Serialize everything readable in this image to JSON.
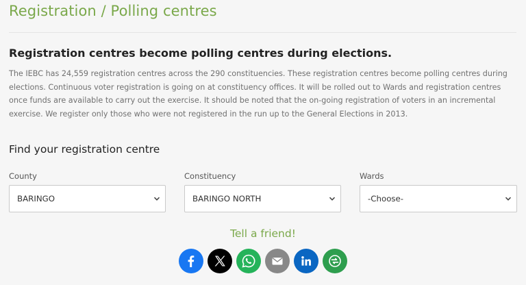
{
  "page_title": "Registration / Polling centres",
  "section_heading": "Registration centres become polling centres during elections.",
  "intro_text": "The IEBC has 24,559 registration centres across the 290 constituencies. These registration centres become polling centres during elections. Continuous voter registration is going on at constituency offices. It will be rolled out to Wards and registration centres once funds are available to carry out the exercise. It should be noted that the on-going registration of voters in an incremental exercise. We register only those who were not registered in the run up to the General Elections in 2013.",
  "find_heading": "Find your registration centre",
  "filters": {
    "county": {
      "label": "County",
      "value": "BARINGO"
    },
    "constituency": {
      "label": "Constituency",
      "value": "BARINGO NORTH"
    },
    "wards": {
      "label": "Wards",
      "value": "-Choose-"
    }
  },
  "share": {
    "title": "Tell a friend!",
    "buttons": [
      {
        "icon": "facebook-icon",
        "color": "#1877f2"
      },
      {
        "icon": "x-icon",
        "color": "#000000"
      },
      {
        "icon": "whatsapp-icon",
        "color": "#25b35a"
      },
      {
        "icon": "email-icon",
        "color": "#888888"
      },
      {
        "icon": "linkedin-icon",
        "color": "#0a66c2"
      },
      {
        "icon": "more-icon",
        "color": "#2e9e4e"
      }
    ]
  }
}
